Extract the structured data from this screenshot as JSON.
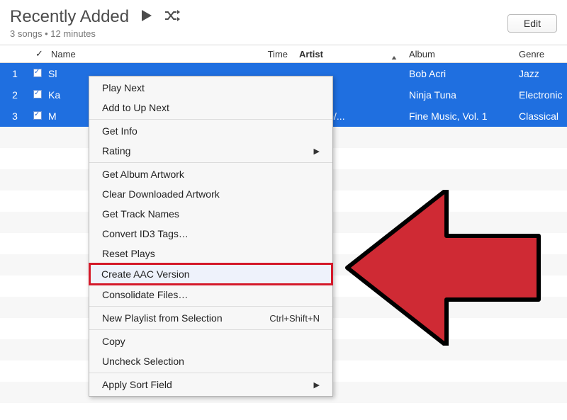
{
  "header": {
    "title": "Recently Added",
    "subtitle": "3 songs • 12 minutes",
    "edit_label": "Edit"
  },
  "columns": {
    "name": "Name",
    "time": "Time",
    "artist": "Artist",
    "album": "Album",
    "genre": "Genre"
  },
  "rows": [
    {
      "num": "1",
      "name": "Sl",
      "time": "",
      "artist": "",
      "album": "Bob Acri",
      "genre": "Jazz"
    },
    {
      "num": "2",
      "name": "Ka",
      "time": "",
      "artist": "",
      "album": "Ninja Tuna",
      "genre": "Electronic"
    },
    {
      "num": "3",
      "name": "M",
      "time": "",
      "artist": "oltzman/...",
      "album": "Fine Music, Vol. 1",
      "genre": "Classical"
    }
  ],
  "menu": {
    "play_next": "Play Next",
    "add_up_next": "Add to Up Next",
    "get_info": "Get Info",
    "rating": "Rating",
    "get_album_artwork": "Get Album Artwork",
    "clear_downloaded_artwork": "Clear Downloaded Artwork",
    "get_track_names": "Get Track Names",
    "convert_id3": "Convert ID3 Tags…",
    "reset_plays": "Reset Plays",
    "create_aac": "Create AAC Version",
    "consolidate": "Consolidate Files…",
    "new_playlist": "New Playlist from Selection",
    "new_playlist_shortcut": "Ctrl+Shift+N",
    "copy": "Copy",
    "uncheck": "Uncheck Selection",
    "apply_sort": "Apply Sort Field"
  }
}
